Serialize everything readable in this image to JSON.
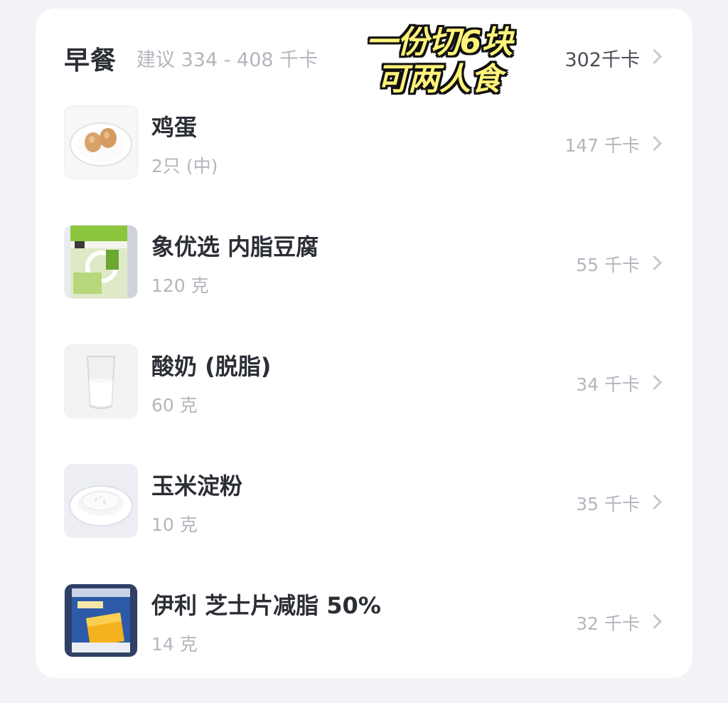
{
  "meal": {
    "title": "早餐",
    "suggestion": "建议 334 - 408 千卡",
    "total": "302千卡"
  },
  "overlay": {
    "line1": "一份切6块",
    "line2": "可两人食"
  },
  "items": [
    {
      "name": "鸡蛋",
      "amount": "2只 (中)",
      "kcal": "147 千卡",
      "icon": "egg-plate-icon"
    },
    {
      "name": "象优选 内脂豆腐",
      "amount": "120 克",
      "kcal": "55 千卡",
      "icon": "tofu-package-icon"
    },
    {
      "name": "酸奶 (脱脂)",
      "amount": "60 克",
      "kcal": "34 千卡",
      "icon": "yogurt-glass-icon"
    },
    {
      "name": "玉米淀粉",
      "amount": "10 克",
      "kcal": "35 千卡",
      "icon": "cornstarch-plate-icon"
    },
    {
      "name": "伊利 芝士片减脂 50%",
      "amount": "14 克",
      "kcal": "32 千卡",
      "icon": "cheese-slice-package-icon"
    }
  ],
  "colors": {
    "background": "#f2f3f7",
    "card": "#ffffff",
    "title": "#2b2e35",
    "muted": "#b3b6bd",
    "overlay_text": "#fff37a"
  }
}
